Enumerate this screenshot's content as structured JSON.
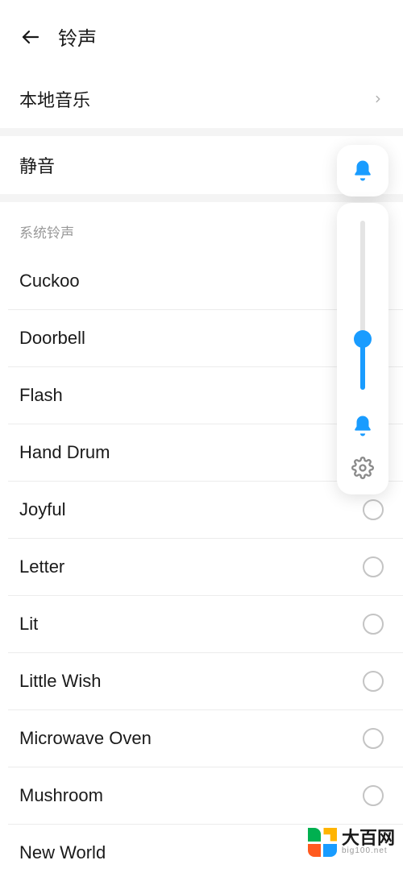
{
  "header": {
    "title": "铃声"
  },
  "local_music": {
    "label": "本地音乐"
  },
  "silent": {
    "label": "静音"
  },
  "section": {
    "system_ringtones_header": "系统铃声"
  },
  "ringtones": [
    {
      "label": "Cuckoo"
    },
    {
      "label": "Doorbell"
    },
    {
      "label": "Flash"
    },
    {
      "label": "Hand Drum"
    },
    {
      "label": "Joyful"
    },
    {
      "label": "Letter"
    },
    {
      "label": "Lit"
    },
    {
      "label": "Little Wish"
    },
    {
      "label": "Microwave Oven"
    },
    {
      "label": "Mushroom"
    },
    {
      "label": "New World"
    }
  ],
  "volume": {
    "level_percent": 30
  },
  "watermark": {
    "big": "大百网",
    "small": "big100.net"
  }
}
